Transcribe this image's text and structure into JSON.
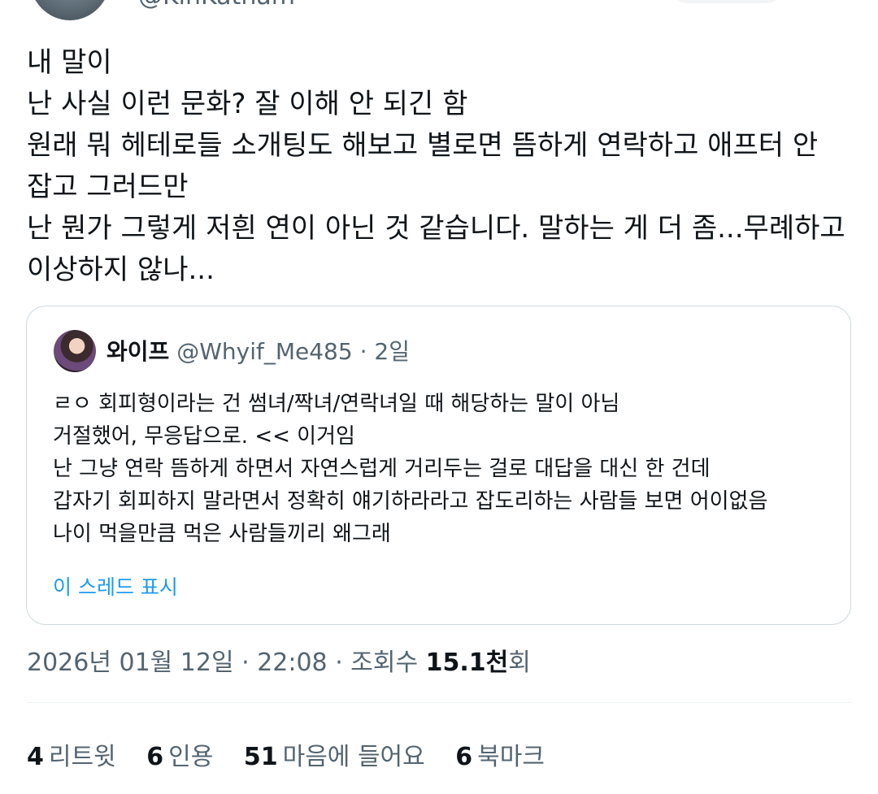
{
  "author": {
    "handle_partial": "@KinKatnam"
  },
  "tweet": {
    "lines": [
      "내 말이",
      "난 사실 이런 문화? 잘 이해 안 되긴 함",
      "원래 뭐 헤테로들 소개팅도 해보고 별로면 뜸하게 연락하고 애프터 안",
      "잡고 그러드만",
      "난 뭔가 그렇게 저흰 연이 아닌 것 같습니다. 말하는 게 더 좀...무례하고",
      "이상하지 않나..."
    ]
  },
  "quote": {
    "name": "와이프",
    "handle": "@Whyif_Me485",
    "dot": "·",
    "time": "2일",
    "lines": [
      "ㄹㅇ 회피형이라는 건 썸녀/짝녀/연락녀일 때 해당하는 말이 아님",
      "거절했어, 무응답으로. << 이거임",
      "난 그냥 연락 뜸하게 하면서 자연스럽게 거리두는 걸로 대답을 대신 한 건데",
      "갑자기 회피하지 말라면서 정확히 얘기하라라고 잡도리하는 사람들 보면 어이없음",
      "나이 먹을만큼 먹은 사람들끼리 왜그래"
    ],
    "show_thread": "이 스레드 표시"
  },
  "meta": {
    "date": "2026년 01월 12일",
    "sep1": " · ",
    "time": "22:08",
    "sep2": " · ",
    "views_label": "조회수 ",
    "views_value": "15.1천",
    "views_suffix": "회"
  },
  "stats": {
    "retweets_count": "4",
    "retweets_label": "리트윗",
    "quotes_count": "6",
    "quotes_label": "인용",
    "likes_count": "51",
    "likes_label": "마음에 들어요",
    "bookmarks_count": "6",
    "bookmarks_label": "북마크"
  },
  "colors": {
    "text": "#0f1419",
    "secondary": "#536471",
    "link": "#1d9bf0",
    "border": "#cfd9de",
    "divider": "#eff3f4"
  }
}
